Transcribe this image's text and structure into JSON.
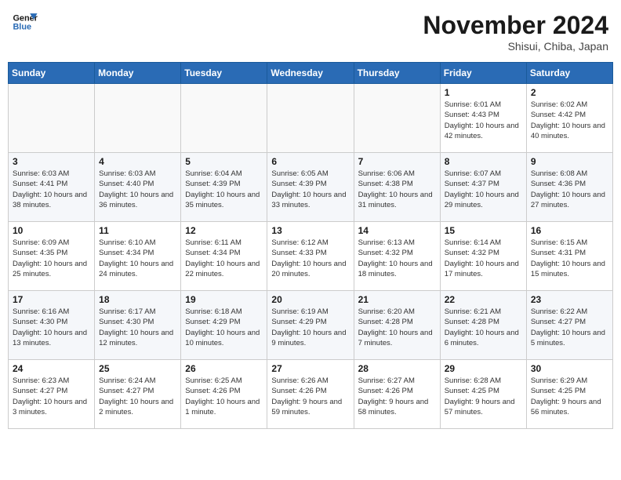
{
  "header": {
    "logo_line1": "General",
    "logo_line2": "Blue",
    "month": "November 2024",
    "location": "Shisui, Chiba, Japan"
  },
  "weekdays": [
    "Sunday",
    "Monday",
    "Tuesday",
    "Wednesday",
    "Thursday",
    "Friday",
    "Saturday"
  ],
  "weeks": [
    [
      {
        "day": "",
        "info": ""
      },
      {
        "day": "",
        "info": ""
      },
      {
        "day": "",
        "info": ""
      },
      {
        "day": "",
        "info": ""
      },
      {
        "day": "",
        "info": ""
      },
      {
        "day": "1",
        "info": "Sunrise: 6:01 AM\nSunset: 4:43 PM\nDaylight: 10 hours and 42 minutes."
      },
      {
        "day": "2",
        "info": "Sunrise: 6:02 AM\nSunset: 4:42 PM\nDaylight: 10 hours and 40 minutes."
      }
    ],
    [
      {
        "day": "3",
        "info": "Sunrise: 6:03 AM\nSunset: 4:41 PM\nDaylight: 10 hours and 38 minutes."
      },
      {
        "day": "4",
        "info": "Sunrise: 6:03 AM\nSunset: 4:40 PM\nDaylight: 10 hours and 36 minutes."
      },
      {
        "day": "5",
        "info": "Sunrise: 6:04 AM\nSunset: 4:39 PM\nDaylight: 10 hours and 35 minutes."
      },
      {
        "day": "6",
        "info": "Sunrise: 6:05 AM\nSunset: 4:39 PM\nDaylight: 10 hours and 33 minutes."
      },
      {
        "day": "7",
        "info": "Sunrise: 6:06 AM\nSunset: 4:38 PM\nDaylight: 10 hours and 31 minutes."
      },
      {
        "day": "8",
        "info": "Sunrise: 6:07 AM\nSunset: 4:37 PM\nDaylight: 10 hours and 29 minutes."
      },
      {
        "day": "9",
        "info": "Sunrise: 6:08 AM\nSunset: 4:36 PM\nDaylight: 10 hours and 27 minutes."
      }
    ],
    [
      {
        "day": "10",
        "info": "Sunrise: 6:09 AM\nSunset: 4:35 PM\nDaylight: 10 hours and 25 minutes."
      },
      {
        "day": "11",
        "info": "Sunrise: 6:10 AM\nSunset: 4:34 PM\nDaylight: 10 hours and 24 minutes."
      },
      {
        "day": "12",
        "info": "Sunrise: 6:11 AM\nSunset: 4:34 PM\nDaylight: 10 hours and 22 minutes."
      },
      {
        "day": "13",
        "info": "Sunrise: 6:12 AM\nSunset: 4:33 PM\nDaylight: 10 hours and 20 minutes."
      },
      {
        "day": "14",
        "info": "Sunrise: 6:13 AM\nSunset: 4:32 PM\nDaylight: 10 hours and 18 minutes."
      },
      {
        "day": "15",
        "info": "Sunrise: 6:14 AM\nSunset: 4:32 PM\nDaylight: 10 hours and 17 minutes."
      },
      {
        "day": "16",
        "info": "Sunrise: 6:15 AM\nSunset: 4:31 PM\nDaylight: 10 hours and 15 minutes."
      }
    ],
    [
      {
        "day": "17",
        "info": "Sunrise: 6:16 AM\nSunset: 4:30 PM\nDaylight: 10 hours and 13 minutes."
      },
      {
        "day": "18",
        "info": "Sunrise: 6:17 AM\nSunset: 4:30 PM\nDaylight: 10 hours and 12 minutes."
      },
      {
        "day": "19",
        "info": "Sunrise: 6:18 AM\nSunset: 4:29 PM\nDaylight: 10 hours and 10 minutes."
      },
      {
        "day": "20",
        "info": "Sunrise: 6:19 AM\nSunset: 4:29 PM\nDaylight: 10 hours and 9 minutes."
      },
      {
        "day": "21",
        "info": "Sunrise: 6:20 AM\nSunset: 4:28 PM\nDaylight: 10 hours and 7 minutes."
      },
      {
        "day": "22",
        "info": "Sunrise: 6:21 AM\nSunset: 4:28 PM\nDaylight: 10 hours and 6 minutes."
      },
      {
        "day": "23",
        "info": "Sunrise: 6:22 AM\nSunset: 4:27 PM\nDaylight: 10 hours and 5 minutes."
      }
    ],
    [
      {
        "day": "24",
        "info": "Sunrise: 6:23 AM\nSunset: 4:27 PM\nDaylight: 10 hours and 3 minutes."
      },
      {
        "day": "25",
        "info": "Sunrise: 6:24 AM\nSunset: 4:27 PM\nDaylight: 10 hours and 2 minutes."
      },
      {
        "day": "26",
        "info": "Sunrise: 6:25 AM\nSunset: 4:26 PM\nDaylight: 10 hours and 1 minute."
      },
      {
        "day": "27",
        "info": "Sunrise: 6:26 AM\nSunset: 4:26 PM\nDaylight: 9 hours and 59 minutes."
      },
      {
        "day": "28",
        "info": "Sunrise: 6:27 AM\nSunset: 4:26 PM\nDaylight: 9 hours and 58 minutes."
      },
      {
        "day": "29",
        "info": "Sunrise: 6:28 AM\nSunset: 4:25 PM\nDaylight: 9 hours and 57 minutes."
      },
      {
        "day": "30",
        "info": "Sunrise: 6:29 AM\nSunset: 4:25 PM\nDaylight: 9 hours and 56 minutes."
      }
    ]
  ]
}
